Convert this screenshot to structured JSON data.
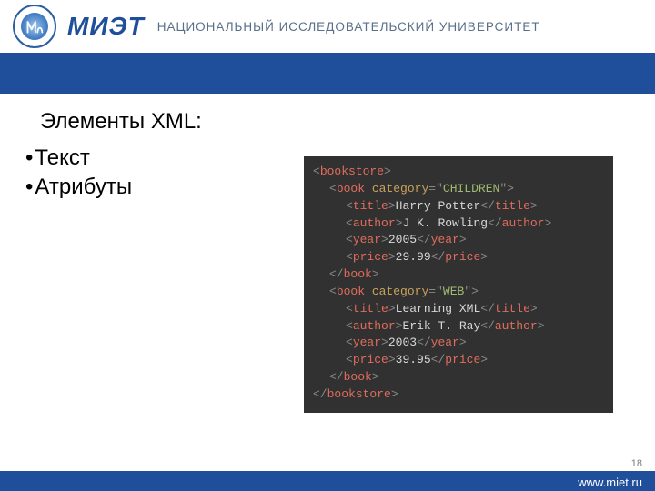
{
  "header": {
    "logo_text": "МИЭТ",
    "university_text": "НАЦИОНАЛЬНЫЙ ИССЛЕДОВАТЕЛЬСКИЙ УНИВЕРСИТЕТ"
  },
  "content": {
    "heading": "Элементы XML:",
    "bullets": [
      "Текст",
      "Атрибуты"
    ]
  },
  "code": {
    "lines": [
      {
        "indent": 0,
        "parts": [
          {
            "c": "punc",
            "t": "<"
          },
          {
            "c": "tag",
            "t": "bookstore"
          },
          {
            "c": "punc",
            "t": ">"
          }
        ]
      },
      {
        "indent": 1,
        "parts": [
          {
            "c": "punc",
            "t": "<"
          },
          {
            "c": "tag",
            "t": "book"
          },
          {
            "c": "text",
            "t": " "
          },
          {
            "c": "attr",
            "t": "category"
          },
          {
            "c": "punc",
            "t": "="
          },
          {
            "c": "punc",
            "t": "\""
          },
          {
            "c": "val",
            "t": "CHILDREN"
          },
          {
            "c": "punc",
            "t": "\""
          },
          {
            "c": "punc",
            "t": ">"
          }
        ]
      },
      {
        "indent": 2,
        "parts": [
          {
            "c": "punc",
            "t": "<"
          },
          {
            "c": "tag",
            "t": "title"
          },
          {
            "c": "punc",
            "t": ">"
          },
          {
            "c": "text",
            "t": "Harry Potter"
          },
          {
            "c": "punc",
            "t": "</"
          },
          {
            "c": "tag",
            "t": "title"
          },
          {
            "c": "punc",
            "t": ">"
          }
        ]
      },
      {
        "indent": 2,
        "parts": [
          {
            "c": "punc",
            "t": "<"
          },
          {
            "c": "tag",
            "t": "author"
          },
          {
            "c": "punc",
            "t": ">"
          },
          {
            "c": "text",
            "t": "J K. Rowling"
          },
          {
            "c": "punc",
            "t": "</"
          },
          {
            "c": "tag",
            "t": "author"
          },
          {
            "c": "punc",
            "t": ">"
          }
        ]
      },
      {
        "indent": 2,
        "parts": [
          {
            "c": "punc",
            "t": "<"
          },
          {
            "c": "tag",
            "t": "year"
          },
          {
            "c": "punc",
            "t": ">"
          },
          {
            "c": "text",
            "t": "2005"
          },
          {
            "c": "punc",
            "t": "</"
          },
          {
            "c": "tag",
            "t": "year"
          },
          {
            "c": "punc",
            "t": ">"
          }
        ]
      },
      {
        "indent": 2,
        "parts": [
          {
            "c": "punc",
            "t": "<"
          },
          {
            "c": "tag",
            "t": "price"
          },
          {
            "c": "punc",
            "t": ">"
          },
          {
            "c": "text",
            "t": "29.99"
          },
          {
            "c": "punc",
            "t": "</"
          },
          {
            "c": "tag",
            "t": "price"
          },
          {
            "c": "punc",
            "t": ">"
          }
        ]
      },
      {
        "indent": 1,
        "parts": [
          {
            "c": "punc",
            "t": "</"
          },
          {
            "c": "tag",
            "t": "book"
          },
          {
            "c": "punc",
            "t": ">"
          }
        ]
      },
      {
        "indent": 1,
        "parts": [
          {
            "c": "punc",
            "t": "<"
          },
          {
            "c": "tag",
            "t": "book"
          },
          {
            "c": "text",
            "t": " "
          },
          {
            "c": "attr",
            "t": "category"
          },
          {
            "c": "punc",
            "t": "="
          },
          {
            "c": "punc",
            "t": "\""
          },
          {
            "c": "val",
            "t": "WEB"
          },
          {
            "c": "punc",
            "t": "\""
          },
          {
            "c": "punc",
            "t": ">"
          }
        ]
      },
      {
        "indent": 2,
        "parts": [
          {
            "c": "punc",
            "t": "<"
          },
          {
            "c": "tag",
            "t": "title"
          },
          {
            "c": "punc",
            "t": ">"
          },
          {
            "c": "text",
            "t": "Learning XML"
          },
          {
            "c": "punc",
            "t": "</"
          },
          {
            "c": "tag",
            "t": "title"
          },
          {
            "c": "punc",
            "t": ">"
          }
        ]
      },
      {
        "indent": 2,
        "parts": [
          {
            "c": "punc",
            "t": "<"
          },
          {
            "c": "tag",
            "t": "author"
          },
          {
            "c": "punc",
            "t": ">"
          },
          {
            "c": "text",
            "t": "Erik T. Ray"
          },
          {
            "c": "punc",
            "t": "</"
          },
          {
            "c": "tag",
            "t": "author"
          },
          {
            "c": "punc",
            "t": ">"
          }
        ]
      },
      {
        "indent": 2,
        "parts": [
          {
            "c": "punc",
            "t": "<"
          },
          {
            "c": "tag",
            "t": "year"
          },
          {
            "c": "punc",
            "t": ">"
          },
          {
            "c": "text",
            "t": "2003"
          },
          {
            "c": "punc",
            "t": "</"
          },
          {
            "c": "tag",
            "t": "year"
          },
          {
            "c": "punc",
            "t": ">"
          }
        ]
      },
      {
        "indent": 2,
        "parts": [
          {
            "c": "punc",
            "t": "<"
          },
          {
            "c": "tag",
            "t": "price"
          },
          {
            "c": "punc",
            "t": ">"
          },
          {
            "c": "text",
            "t": "39.95"
          },
          {
            "c": "punc",
            "t": "</"
          },
          {
            "c": "tag",
            "t": "price"
          },
          {
            "c": "punc",
            "t": ">"
          }
        ]
      },
      {
        "indent": 1,
        "parts": [
          {
            "c": "punc",
            "t": "</"
          },
          {
            "c": "tag",
            "t": "book"
          },
          {
            "c": "punc",
            "t": ">"
          }
        ]
      },
      {
        "indent": 0,
        "parts": [
          {
            "c": "punc",
            "t": "</"
          },
          {
            "c": "tag",
            "t": "bookstore"
          },
          {
            "c": "punc",
            "t": ">"
          }
        ]
      }
    ]
  },
  "footer": {
    "page_number": "18",
    "url": "www.miet.ru"
  }
}
